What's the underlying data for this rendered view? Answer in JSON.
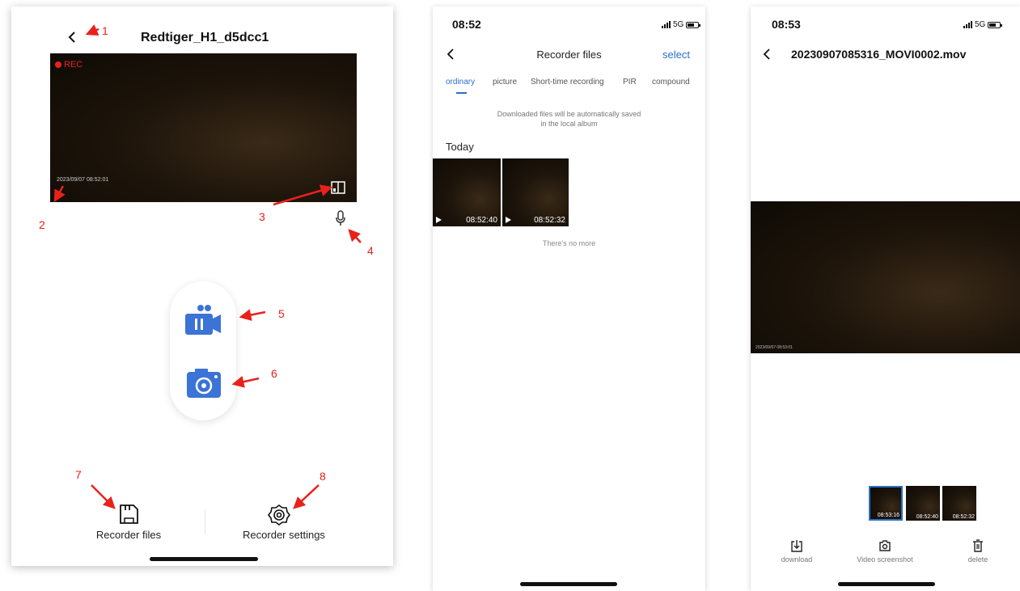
{
  "screen1": {
    "title": "Redtiger_H1_d5dcc1",
    "rec_label": "REC",
    "timestamp": "2023/09/07  08:52:01",
    "recorder_files_label": "Recorder files",
    "recorder_settings_label": "Recorder settings",
    "annotations": [
      "1",
      "2",
      "3",
      "4",
      "5",
      "6",
      "7",
      "8"
    ],
    "colors": {
      "accent": "#e8221b",
      "icon_blue": "#3b73d6"
    }
  },
  "screen2": {
    "time": "08:52",
    "network": "5G",
    "title": "Recorder files",
    "select_label": "select",
    "tabs": [
      "ordinary",
      "picture",
      "Short-time recording",
      "PIR",
      "compound"
    ],
    "active_tab": "ordinary",
    "notice_line1": "Downloaded files will be automatically saved",
    "notice_line2": "in the local album",
    "section": "Today",
    "thumbnails": [
      "08:52:40",
      "08:52:32"
    ],
    "end_text": "There's no more",
    "colors": {
      "accent": "#2a6fc9"
    }
  },
  "screen3": {
    "time": "08:53",
    "network": "5G",
    "title": "20230907085316_MOVI0002.mov",
    "video_timestamp": "2023/09/07  08:53:01",
    "thumbnails": [
      "08:53:16",
      "08:52:40",
      "08:52:32"
    ],
    "actions": [
      "download",
      "Video screenshot",
      "delete"
    ]
  }
}
